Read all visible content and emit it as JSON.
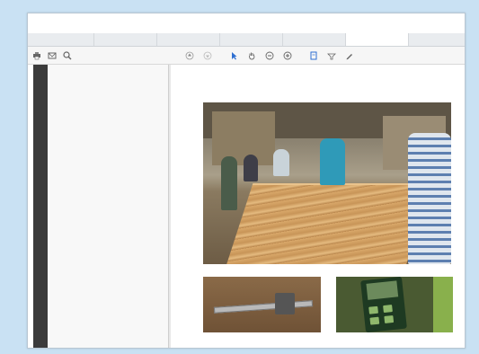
{
  "window": {
    "title": "",
    "menu": [
      "",
      "",
      "",
      "",
      ""
    ]
  },
  "tabs": [
    {
      "label": ""
    },
    {
      "label": ""
    },
    {
      "label": ""
    },
    {
      "label": ""
    },
    {
      "label": ""
    },
    {
      "label": ""
    }
  ],
  "toolbar": {
    "icons": [
      "print-icon",
      "email-icon",
      "search-icon",
      "arrow-up-icon",
      "arrow-down-icon",
      "cursor-icon",
      "hand-icon",
      "zoom-out-icon",
      "zoom-in-icon",
      "fit-page-icon",
      "markup-icon",
      "pen-icon"
    ],
    "page_indicator": "",
    "zoom_level": ""
  },
  "document": {
    "caption": ""
  },
  "colors": {
    "background": "#c9e1f3",
    "accent": "#2e6fd1",
    "caption": "#2c7a3a"
  }
}
